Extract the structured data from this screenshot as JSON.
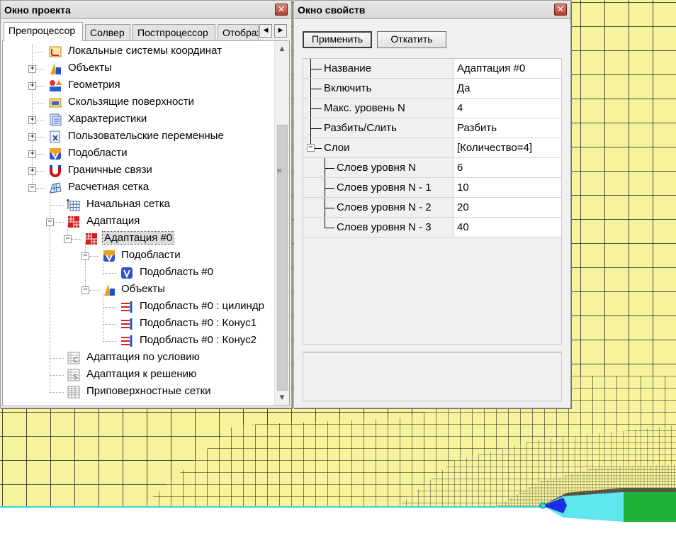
{
  "project_window": {
    "title": "Окно проекта",
    "close_glyph": "✕",
    "tabs": [
      "Препроцессор",
      "Солвер",
      "Постпроцессор",
      "Отображ"
    ],
    "tab_scroll_left": "◀",
    "tab_scroll_right": "▶",
    "tree": {
      "local_cs": "Локальные системы координат",
      "objects": "Объекты",
      "geometry": "Геометрия",
      "sliding_surfaces": "Скользящие поверхности",
      "characteristics": "Характеристики",
      "user_variables": "Пользовательские переменные",
      "subregions": "Подобласти",
      "boundary_links": "Граничные связи",
      "mesh": "Расчетная сетка",
      "initial_mesh": "Начальная сетка",
      "adaptation": "Адаптация",
      "adaptation_0": "Адаптация #0",
      "adapt_subregions": "Подобласти",
      "subregion_0": "Подобласть #0",
      "adapt_objects": "Объекты",
      "obj_cylinder": "Подобласть #0 : цилиндр",
      "obj_cone1": "Подобласть #0 : Конус1",
      "obj_cone2": "Подобласть #0 : Конус2",
      "adapt_condition": "Адаптация по условию",
      "adapt_solution": "Адаптация к решению",
      "near_surface": "Приповерхностные сетки"
    },
    "expander_plus": "+",
    "expander_minus": "−"
  },
  "properties_window": {
    "title": "Окно свойств",
    "close_glyph": "✕",
    "apply_label": "Применить",
    "revert_label": "Откатить",
    "rows": [
      {
        "name": "Название",
        "value": "Адаптация #0"
      },
      {
        "name": "Включить",
        "value": "Да"
      },
      {
        "name": "Макс. уровень N",
        "value": "4"
      },
      {
        "name": "Разбить/Слить",
        "value": "Разбить"
      },
      {
        "name": "Слои",
        "value": "[Количество=4]"
      },
      {
        "name": "Слоев уровня N",
        "value": "6"
      },
      {
        "name": "Слоев уровня N - 1",
        "value": "10"
      },
      {
        "name": "Слоев уровня N - 2",
        "value": "20"
      },
      {
        "name": "Слоев уровня N - 3",
        "value": "40"
      }
    ],
    "collapse_glyph": "−"
  },
  "colors": {
    "mesh_fill": "#f7f39c",
    "mesh_line": "#1e1e1e",
    "axis_line": "#38d6d6",
    "body_cyan": "#5fe6ee",
    "body_green": "#1fb23a",
    "body_blue": "#1c2fe0"
  }
}
